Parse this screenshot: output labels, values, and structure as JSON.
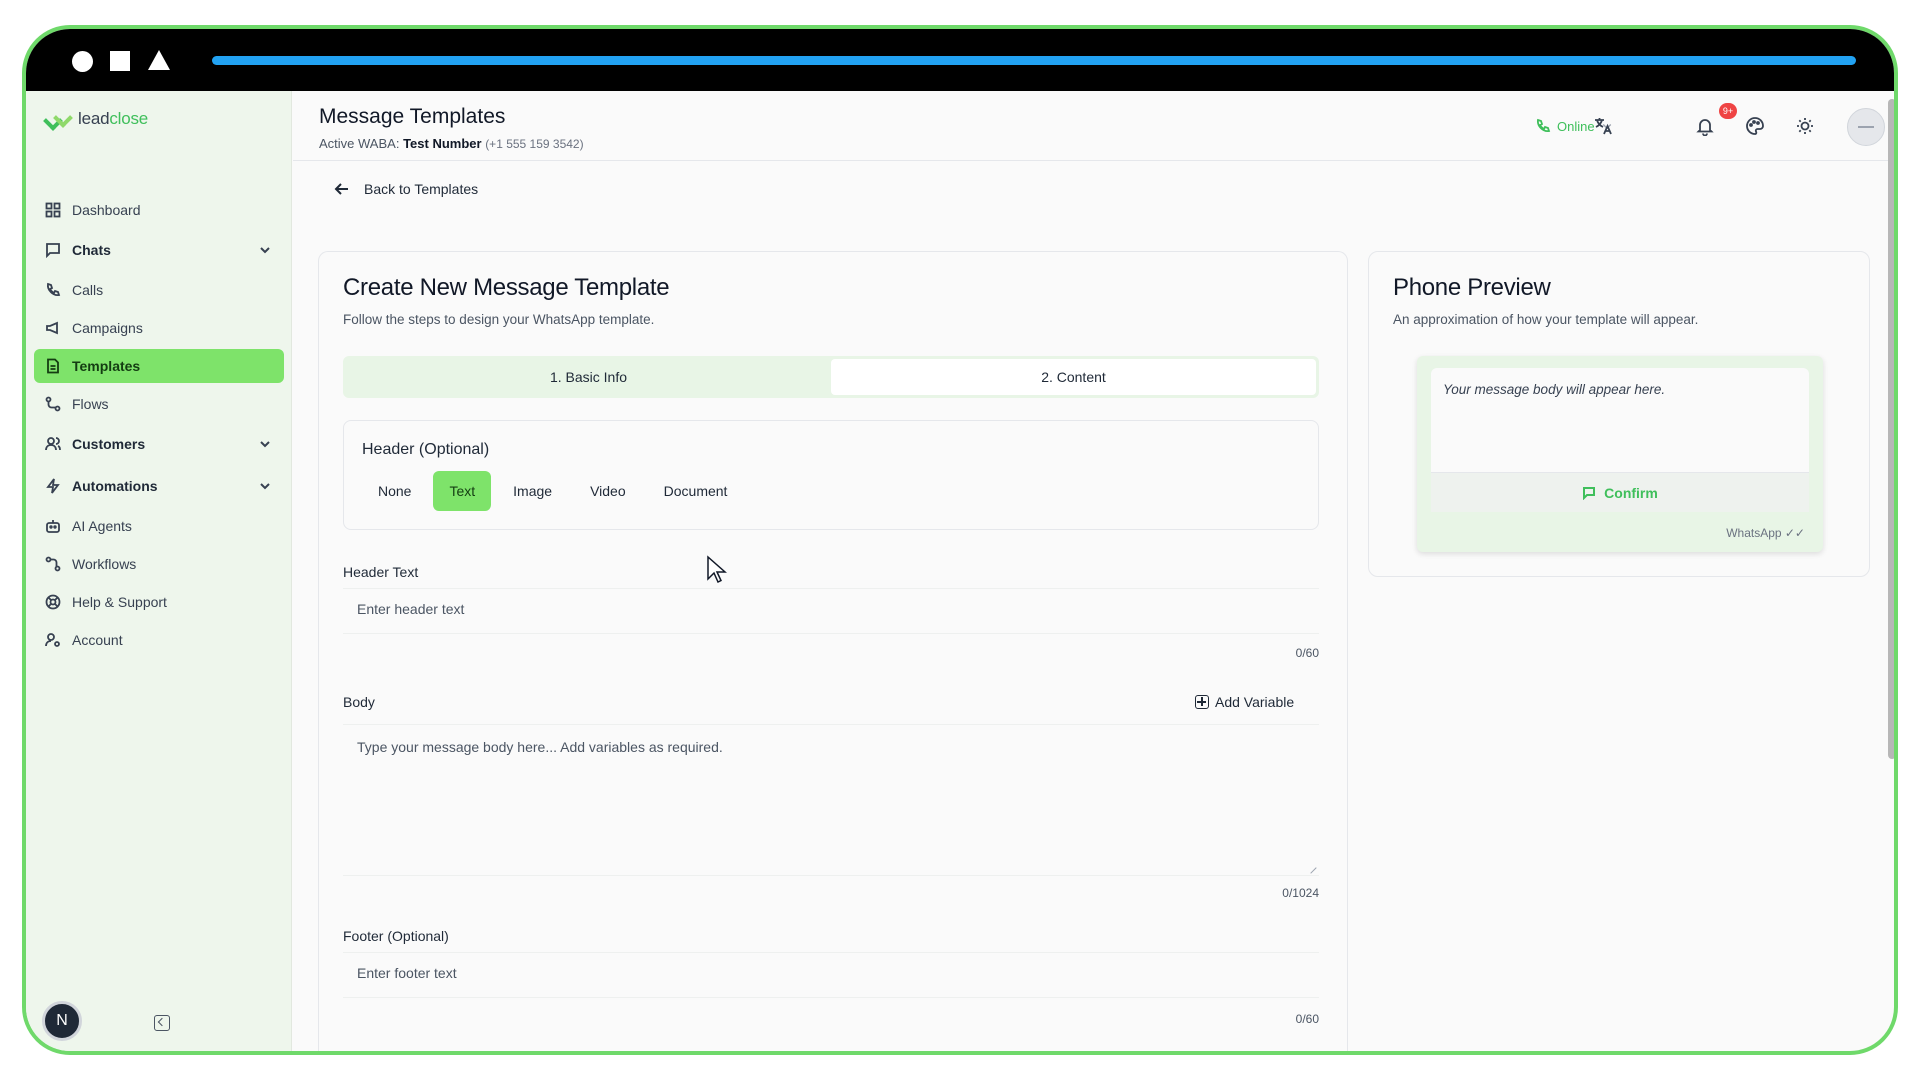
{
  "brand": {
    "logo_part1": "lead",
    "logo_part2": "close"
  },
  "sidebar": {
    "items": [
      {
        "label": "Dashboard"
      },
      {
        "label": "Chats"
      },
      {
        "label": "Calls"
      },
      {
        "label": "Campaigns"
      },
      {
        "label": "Templates"
      },
      {
        "label": "Flows"
      },
      {
        "label": "Customers"
      },
      {
        "label": "Automations"
      },
      {
        "label": "AI Agents"
      },
      {
        "label": "Workflows"
      },
      {
        "label": "Help & Support"
      },
      {
        "label": "Account"
      }
    ],
    "active": "Templates",
    "user_initial": "N"
  },
  "header": {
    "title": "Message Templates",
    "waba_label": "Active WABA:",
    "waba_name": "Test Number",
    "waba_phone": "(+1 555 159 3542)",
    "status": "Online",
    "notification_count": "9+"
  },
  "back_link": "Back to Templates",
  "form": {
    "title": "Create New Message Template",
    "subtitle": "Follow the steps to design your WhatsApp template.",
    "steps": [
      "1. Basic Info",
      "2. Content"
    ],
    "active_step": "2. Content",
    "header_section": {
      "label": "Header (Optional)",
      "options": [
        "None",
        "Text",
        "Image",
        "Video",
        "Document"
      ],
      "selected": "Text"
    },
    "header_text": {
      "label": "Header Text",
      "placeholder": "Enter header text",
      "counter": "0/60"
    },
    "body": {
      "label": "Body",
      "add_variable": "Add Variable",
      "placeholder": "Type your message body here... Add variables as required.",
      "counter": "0/1024"
    },
    "footer": {
      "label": "Footer (Optional)",
      "placeholder": "Enter footer text",
      "counter": "0/60"
    }
  },
  "preview": {
    "title": "Phone Preview",
    "subtitle": "An approximation of how your template will appear.",
    "message_placeholder": "Your message body will appear here.",
    "button_label": "Confirm",
    "wa_tag": "WhatsApp ✓✓"
  },
  "colors": {
    "accent": "#7ee36a",
    "brand_green": "#3fbf5b",
    "frame_border": "#6fd96a",
    "progress": "#22a2f2"
  }
}
